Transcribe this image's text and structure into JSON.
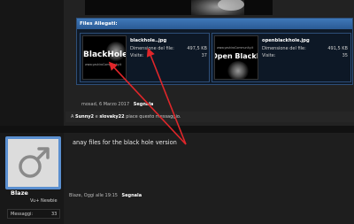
{
  "attachments": {
    "header": "Files Allegati:",
    "items": [
      {
        "thumb_logo": "BlackHole",
        "thumb_url": "www.yashiroCommunity.it",
        "filename": "blackhole..jpg",
        "size_label": "Dimensione del file:",
        "size_value": "497,5 KB",
        "views_label": "Visite:",
        "views_value": "37"
      },
      {
        "thumb_logo": "Open BlackHole",
        "thumb_url": "www.yashiroCommunity.it",
        "filename": "openblackhole.jpg",
        "size_label": "Dimensione del file:",
        "size_value": "491,5 KB",
        "views_label": "Visite:",
        "views_value": "35"
      }
    ]
  },
  "post1": {
    "date": "mosad, 6 Marzo 2017",
    "report": "Segnala",
    "likes_prefix": "A",
    "liker1": "Sunny2",
    "likes_and": "e",
    "liker2": "slovaky22",
    "likes_suffix": "piace questo messaggio."
  },
  "post2": {
    "username": "Blaze",
    "user_title": "Vu+ Newbie",
    "messages_label": "Messaggi:",
    "messages_value": "33",
    "body": "anay files for the black hole version",
    "footer_author": "Blaze, Oggi alle 19:15",
    "report": "Segnala"
  },
  "colors": {
    "accent": "#3f78b8",
    "annotation_arrow": "#e0262a"
  },
  "icons": {
    "avatar": "male-symbol-icon"
  }
}
